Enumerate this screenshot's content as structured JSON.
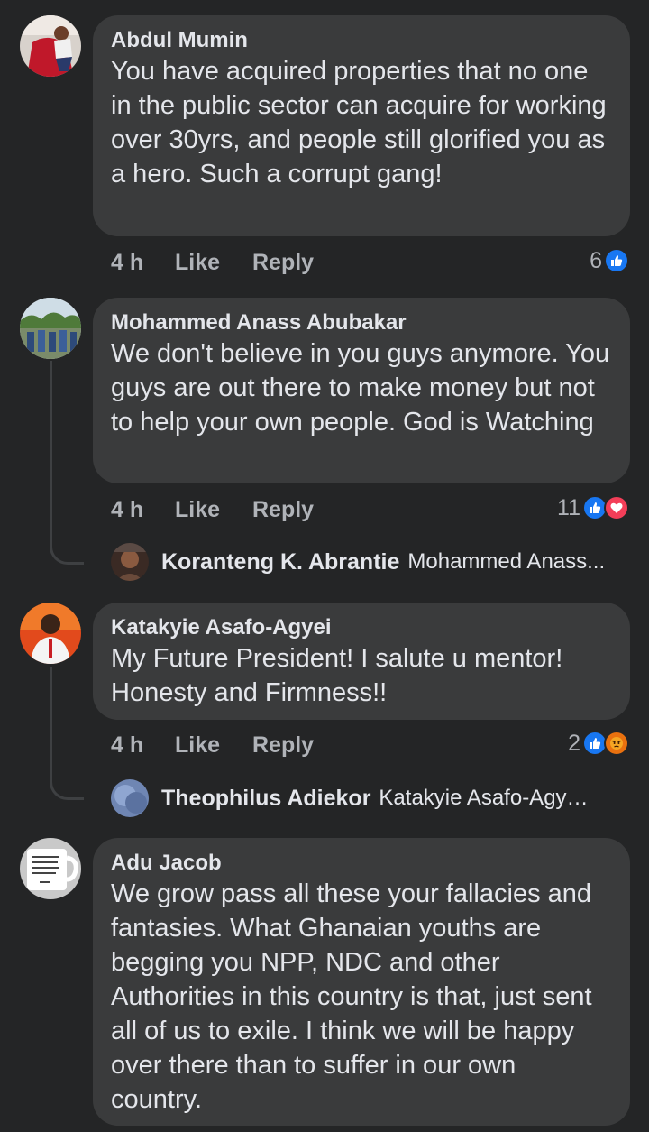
{
  "comments": [
    {
      "author": "Abdul Mumin",
      "text": "You have acquired properties that no one in the public sector can acquire for working over 30yrs, and people still glorified you as a hero. Such a corrupt gang!",
      "time": "4 h",
      "like_label": "Like",
      "reply_label": "Reply",
      "reaction_count": "6",
      "reactions": [
        "like-icon"
      ]
    },
    {
      "author": "Mohammed Anass Abubakar",
      "text": "We don't believe in you guys anymore. You guys are out there to make money but not to help your own people. God is Watching",
      "time": "4 h",
      "like_label": "Like",
      "reply_label": "Reply",
      "reaction_count": "11",
      "reactions": [
        "like-icon",
        "love-icon"
      ],
      "reply_preview": {
        "name": "Koranteng K. Abrantie",
        "text": "Mohammed Anass..."
      }
    },
    {
      "author": "Katakyie Asafo-Agyei",
      "text": "My Future President! I salute u mentor! Honesty and Firmness!!",
      "time": "4 h",
      "like_label": "Like",
      "reply_label": "Reply",
      "reaction_count": "2",
      "reactions": [
        "like-icon",
        "angry-icon"
      ],
      "reply_preview": {
        "name": "Theophilus Adiekor",
        "text": "Katakyie Asafo-Agyei y..."
      }
    },
    {
      "author": "Adu Jacob",
      "text": "We grow pass all these your fallacies and fantasies. What Ghanaian youths are begging you NPP, NDC and other Authorities in this country is that, just sent all of us to exile. I think we will be happy over there than to suffer in our own country."
    }
  ],
  "colors": {
    "background": "#242526",
    "bubble": "#3a3b3c",
    "primary_text": "#e4e6eb",
    "secondary_text": "#b0b3b8",
    "like_blue": "#1877f2",
    "love_red": "#f33e58",
    "angry_orange": "#e9710f"
  }
}
